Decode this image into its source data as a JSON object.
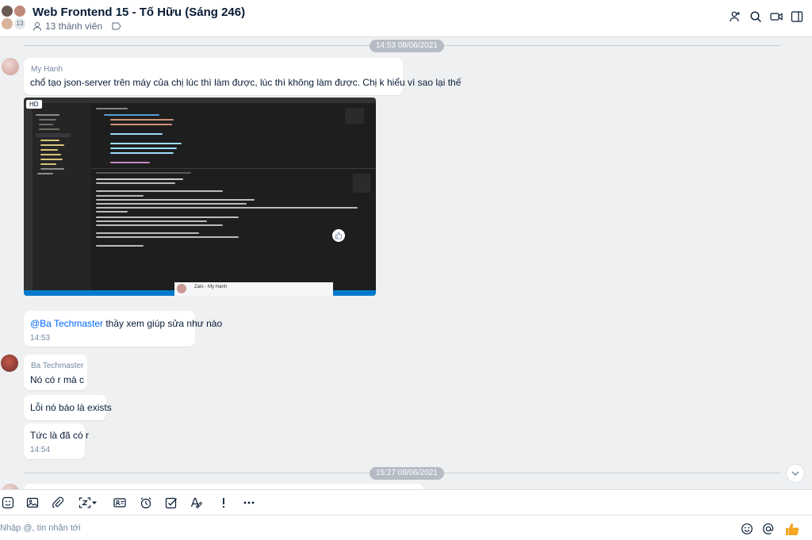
{
  "header": {
    "title": "Web Frontend 15 - Tố Hữu (Sáng 246)",
    "member_count_badge": "13",
    "members": "13 thành viên"
  },
  "messages": {
    "date1": "14:53 08/06/2021",
    "date2": "15:27 08/06/2021",
    "m1_sender": "My Hanh",
    "m1_text": "chổ tạo  json-server trên máy của chị lúc thì làm  được, lúc thì không làm được. Chị k hiểu vì sao lại thế",
    "hd_badge": "HD",
    "zalo_popup": "Zalo - My Hanh",
    "m2_mention": "@Ba Techmaster",
    "m2_text": " thầy xem giúp sửa như nào",
    "m2_time": "14:53",
    "m3_sender": "Ba Techmaster",
    "m3_text": "Nó có r mà c",
    "m4_text": "Lỗi nó báo là exists",
    "m5_text": "Tức là đã có r",
    "m5_time": "14:54"
  },
  "input": {
    "placeholder": "Nhập @, tin nhắn tới"
  },
  "colors": {
    "accent": "#0068ff",
    "thumb": "#f5a623"
  }
}
